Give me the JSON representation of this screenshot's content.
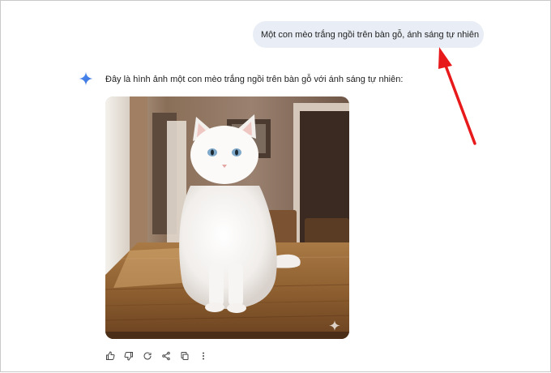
{
  "conversation": {
    "user_prompt": "Một con mèo trắng ngồi trên bàn gỗ, ánh sáng tự nhiên",
    "response_intro": "Đây là hình ảnh một con mèo trắng ngồi trên bàn gỗ với ánh sáng tự nhiên:"
  },
  "generated_image": {
    "subject": "white cat sitting on a wooden table"
  },
  "actions": [
    {
      "name": "thumbs-up-icon"
    },
    {
      "name": "thumbs-down-icon"
    },
    {
      "name": "regenerate-icon"
    },
    {
      "name": "share-icon"
    },
    {
      "name": "copy-icon"
    },
    {
      "name": "more-vert-icon"
    }
  ],
  "colors": {
    "user_bubble": "#e9eef6",
    "annotation_arrow": "#e8191b",
    "gemini_sparkle": "#4a86e8"
  }
}
